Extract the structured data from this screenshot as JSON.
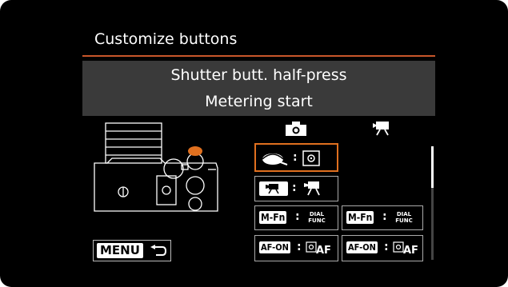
{
  "screen": {
    "title": "Customize buttons",
    "selected_button_name": "Shutter butt. half-press",
    "selected_function": "Metering start"
  },
  "columns": {
    "left": "camera-icon",
    "right": "movie-camera-icon"
  },
  "rows": [
    {
      "left_badge": "shutter-icon",
      "left_value": "metering-icon",
      "right_badge": "",
      "right_value": ""
    },
    {
      "left_badge": "movie-button-icon",
      "left_value": "movie-icon",
      "right_badge": "",
      "right_value": ""
    },
    {
      "left_badge": "M-Fn",
      "left_value_line1": "DIAL",
      "left_value_line2": "FUNC",
      "right_badge": "M-Fn",
      "right_value_line1": "DIAL",
      "right_value_line2": "FUNC"
    },
    {
      "left_badge": "AF-ON",
      "left_value_text": "AF",
      "right_badge": "AF-ON",
      "right_value_text": "AF"
    }
  ],
  "menu_button": {
    "label": "MENU"
  },
  "colors": {
    "accent": "#e0701f",
    "panel": "#3a3a3a"
  }
}
